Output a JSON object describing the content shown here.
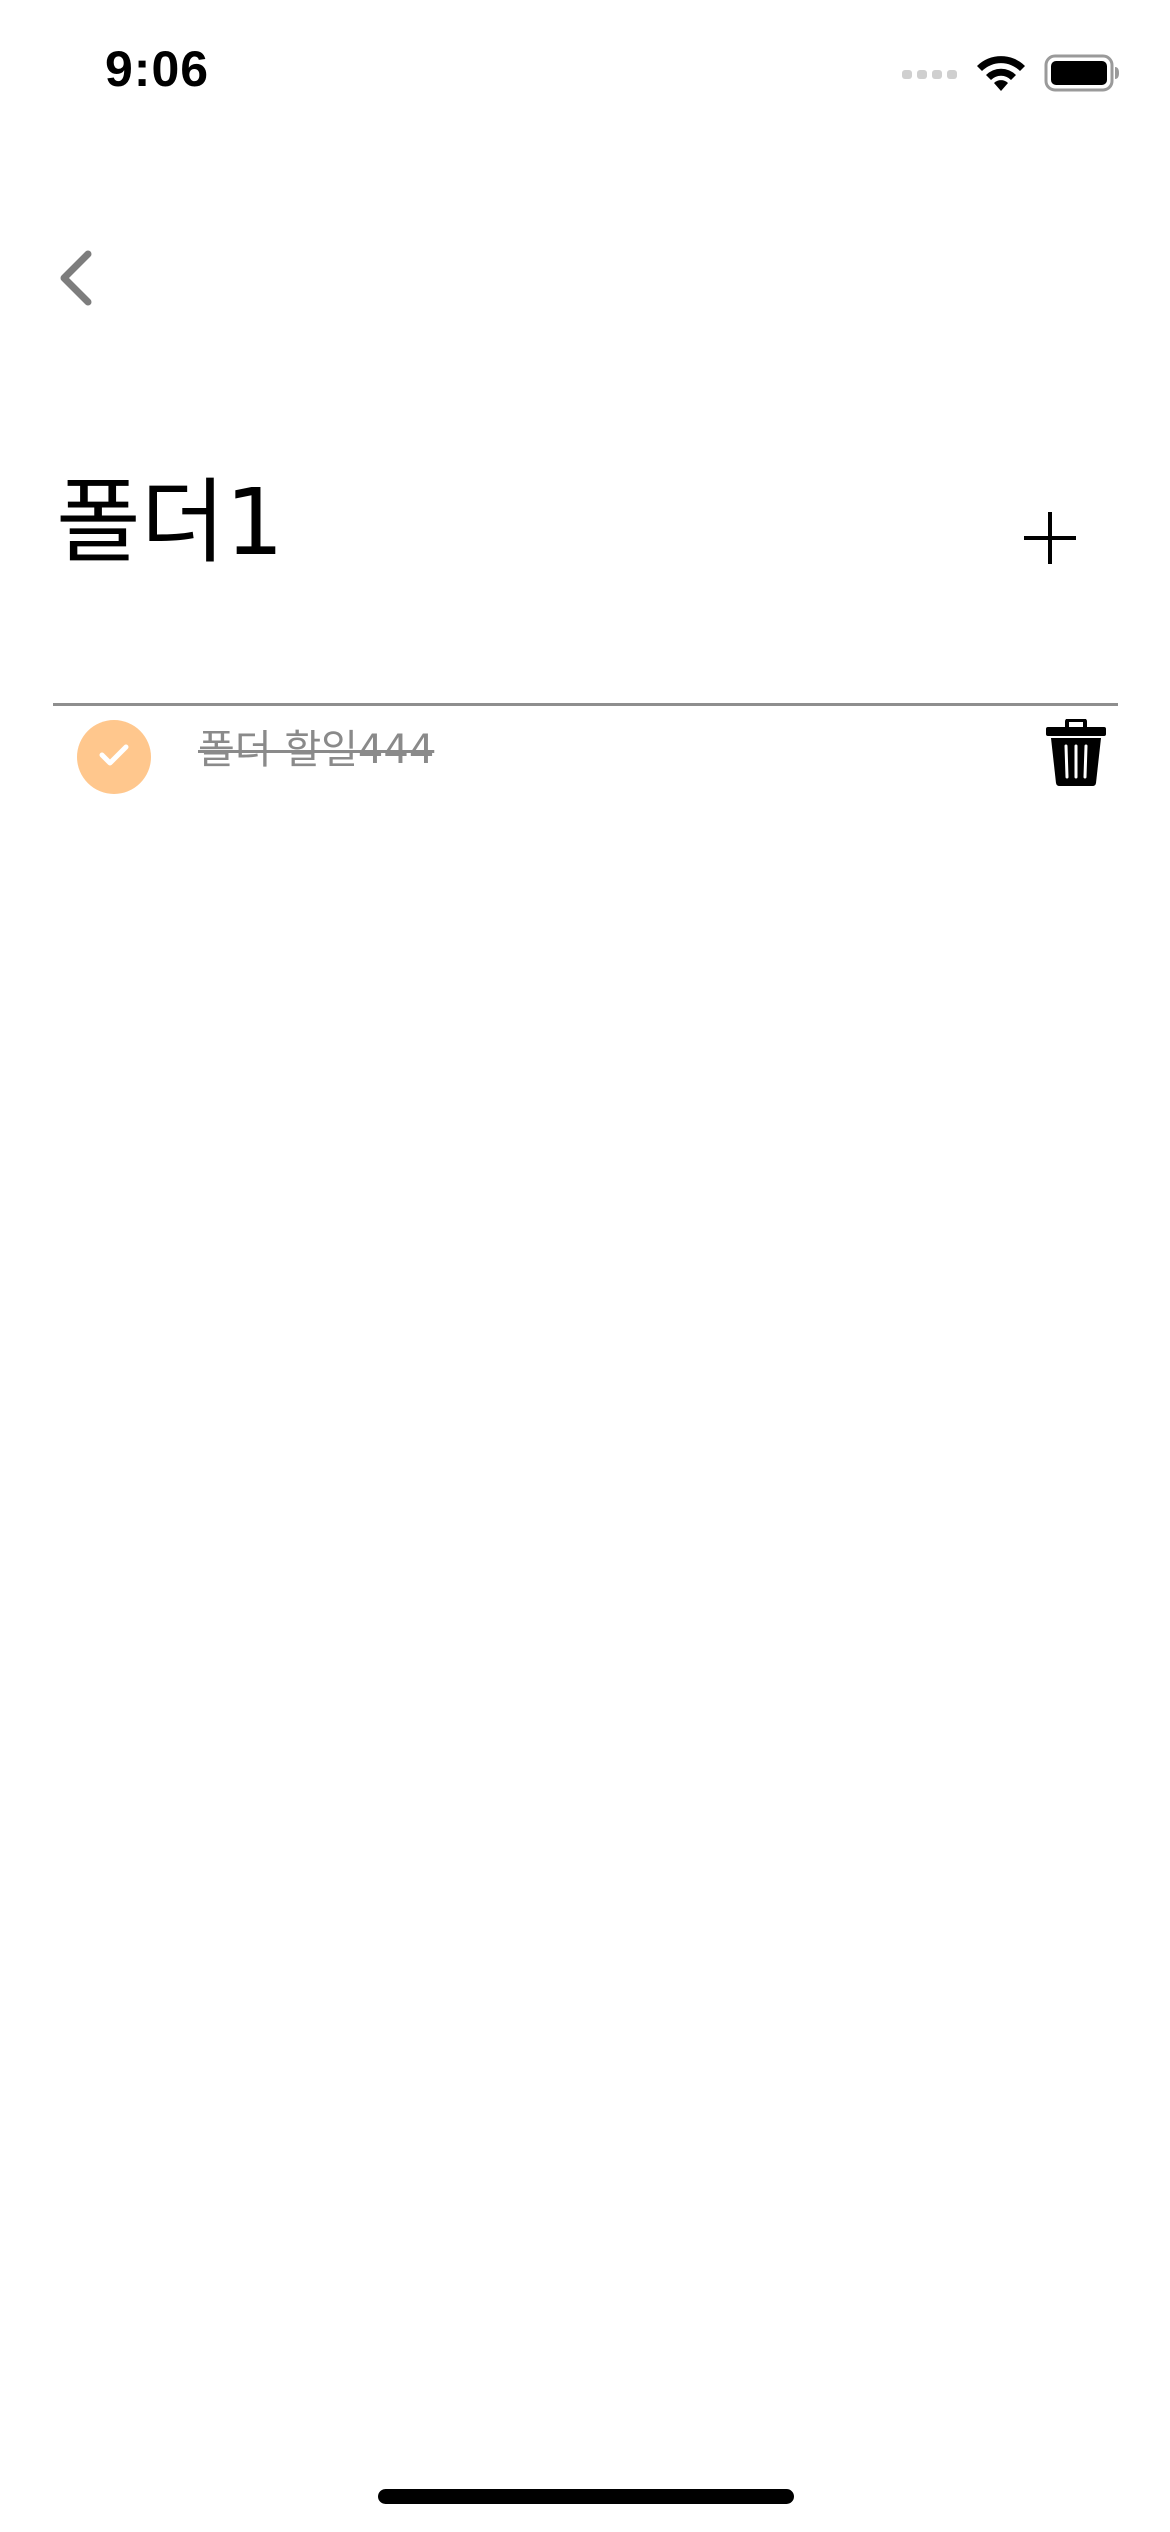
{
  "status_bar": {
    "time": "9:06",
    "signal_icon": "cellular-signal-icon",
    "wifi_icon": "wifi-icon",
    "battery_icon": "battery-icon"
  },
  "nav": {
    "back_icon": "chevron-left-icon"
  },
  "header": {
    "title": "폴더1",
    "add_icon": "plus-icon"
  },
  "todos": [
    {
      "text": "폴더 할일444",
      "completed": true,
      "check_icon": "checkmark-icon",
      "delete_icon": "trash-icon"
    }
  ],
  "colors": {
    "check_fill": "#ffc78d",
    "completed_text": "#8a8a8a",
    "divider": "#8e8e8e",
    "back_chevron": "#7d7d7d"
  }
}
